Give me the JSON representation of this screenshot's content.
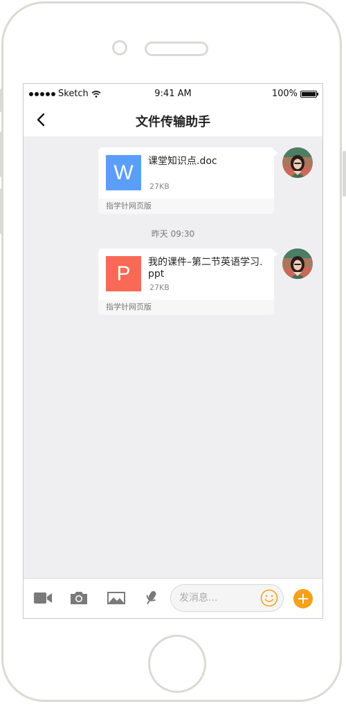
{
  "status_bar": {
    "carrier": "Sketch",
    "time": "9:41 AM",
    "battery": "100%"
  },
  "header": {
    "title": "文件传输助手"
  },
  "messages": [
    {
      "file_name": "课堂知识点.doc",
      "file_size": "27KB",
      "file_icon_letter": "W",
      "file_icon_color": "#5b9ef9",
      "source": "指学针网页版"
    },
    {
      "file_name": "我的课件–第二节英语学习.ppt",
      "file_size": "27KB",
      "file_icon_letter": "P",
      "file_icon_color": "#f86a56",
      "source": "指学针网页版"
    }
  ],
  "timestamp": "昨天 09:30",
  "toolbar": {
    "icons": [
      "video-icon",
      "camera-icon",
      "image-icon",
      "microphone-icon"
    ],
    "input_placeholder": "发消息...",
    "accent_color": "#f5a11a"
  }
}
